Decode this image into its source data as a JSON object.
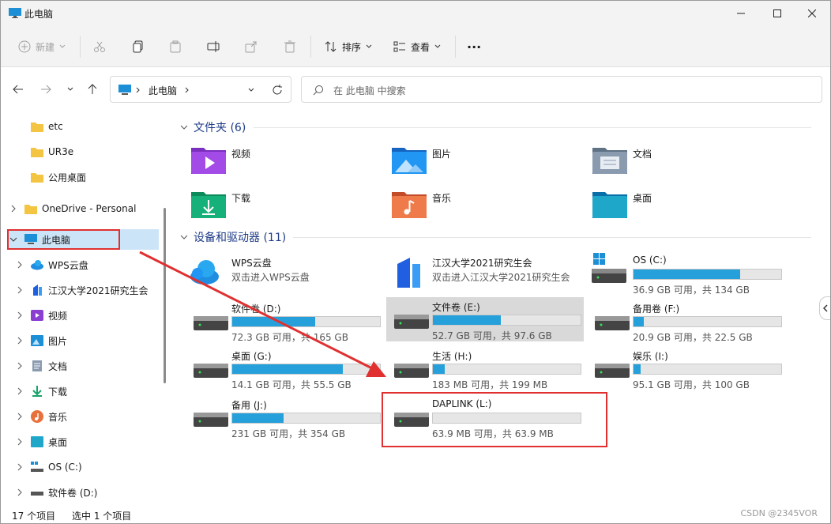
{
  "window": {
    "title": "此电脑"
  },
  "toolbar": {
    "new_label": "新建",
    "sort_label": "排序",
    "view_label": "查看",
    "more_label": "···"
  },
  "address": {
    "crumb": "此电脑"
  },
  "search": {
    "placeholder": "在 此电脑 中搜索"
  },
  "sidebar": {
    "items": [
      {
        "label": "etc"
      },
      {
        "label": "UR3e"
      },
      {
        "label": "公用桌面"
      },
      {
        "label": "OneDrive - Personal"
      },
      {
        "label": "此电脑"
      },
      {
        "label": "WPS云盘"
      },
      {
        "label": "江汉大学2021研究生会"
      },
      {
        "label": "视频"
      },
      {
        "label": "图片"
      },
      {
        "label": "文档"
      },
      {
        "label": "下载"
      },
      {
        "label": "音乐"
      },
      {
        "label": "桌面"
      },
      {
        "label": "OS (C:)"
      },
      {
        "label": "软件卷 (D:)"
      }
    ]
  },
  "sections": {
    "folders_title": "文件夹 (6)",
    "drives_title": "设备和驱动器 (11)"
  },
  "folders": [
    {
      "name": "视频"
    },
    {
      "name": "图片"
    },
    {
      "name": "文档"
    },
    {
      "name": "下载"
    },
    {
      "name": "音乐"
    },
    {
      "name": "桌面"
    }
  ],
  "cloud": [
    {
      "name": "WPS云盘",
      "sub": "双击进入WPS云盘"
    },
    {
      "name": "江汉大学2021研究生会",
      "sub": "双击进入江汉大学2021研究生会"
    }
  ],
  "drives": [
    {
      "name": "OS (C:)",
      "sub": "36.9 GB 可用，共 134 GB",
      "used_fraction": 0.72
    },
    {
      "name": "软件卷 (D:)",
      "sub": "72.3 GB 可用，共 165 GB",
      "used_fraction": 0.56
    },
    {
      "name": "文件卷 (E:)",
      "sub": "52.7 GB 可用，共 97.6 GB",
      "used_fraction": 0.46
    },
    {
      "name": "备用卷 (F:)",
      "sub": "20.9 GB 可用，共 22.5 GB",
      "used_fraction": 0.07
    },
    {
      "name": "桌面 (G:)",
      "sub": "14.1 GB 可用，共 55.5 GB",
      "used_fraction": 0.75
    },
    {
      "name": "生活 (H:)",
      "sub": "183 MB 可用，共 199 MB",
      "used_fraction": 0.08
    },
    {
      "name": "娱乐 (I:)",
      "sub": "95.1 GB 可用，共 100 GB",
      "used_fraction": 0.05
    },
    {
      "name": "备用 (J:)",
      "sub": "231 GB 可用，共 354 GB",
      "used_fraction": 0.35
    },
    {
      "name": "DAPLINK (L:)",
      "sub": "63.9 MB 可用，共 63.9 MB",
      "used_fraction": 0.0
    }
  ],
  "status": {
    "count": "17 个项目",
    "selected": "选中 1 个项目"
  },
  "watermark": "CSDN @2345VOR",
  "colors": {
    "accent": "#26a0da",
    "highlight": "#e03030",
    "selected_bg": "#cce4f7"
  }
}
